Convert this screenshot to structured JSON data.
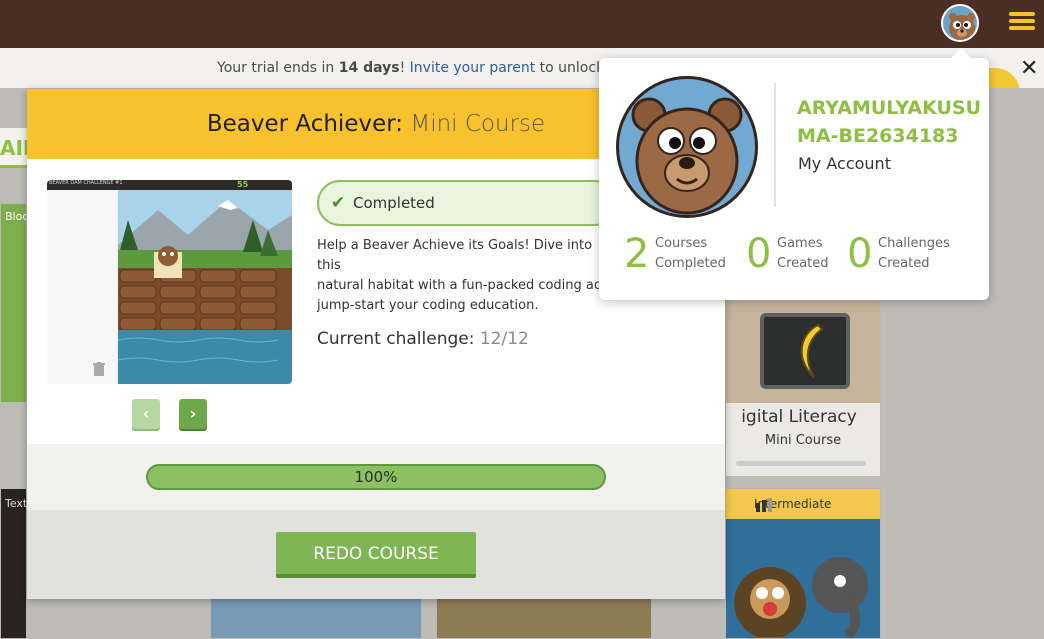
{
  "trial": {
    "prefix": "Your trial ends in ",
    "days": "14 days",
    "mid": "! ",
    "link": "Invite your parent",
    "suffix": " to unlock pre"
  },
  "background": {
    "left_tab": "AIL",
    "tab1": "Bloc",
    "tab2": "Text",
    "card_title": "igital Literacy",
    "card_subtitle": "Mini Course",
    "level_badge": "Intermediate",
    "badge_partial": "n"
  },
  "modal": {
    "title_bold": "Beaver Achiever:",
    "title_light": "Mini Course",
    "completed_label": "Completed",
    "description": "Help a Beaver Achieve its Goals! Dive into this\nnatural habitat with a fun-packed coding act\njump-start your coding education.",
    "current_challenge_label": "Current challenge:",
    "current_challenge_value": "12/12",
    "progress_label": "100%",
    "progress_value": 1.0,
    "redo_button": "REDO COURSE",
    "prev_icon": "chevron-left-icon",
    "next_icon": "chevron-right-icon",
    "thumb_header": "BEAVER DAM CHALLENGE #1",
    "thumb_score": "55"
  },
  "profile": {
    "username": "ARYAMULYAKUSUMA-BE2634183",
    "my_account": "My Account",
    "stats": [
      {
        "value": "2",
        "label": "Courses\nCompleted"
      },
      {
        "value": "0",
        "label": "Games\nCreated"
      },
      {
        "value": "0",
        "label": "Challenges\nCreated"
      }
    ]
  },
  "colors": {
    "accent_green": "#8dc042",
    "header_brown": "#4a2f25",
    "modal_yellow": "#f8c12e"
  }
}
